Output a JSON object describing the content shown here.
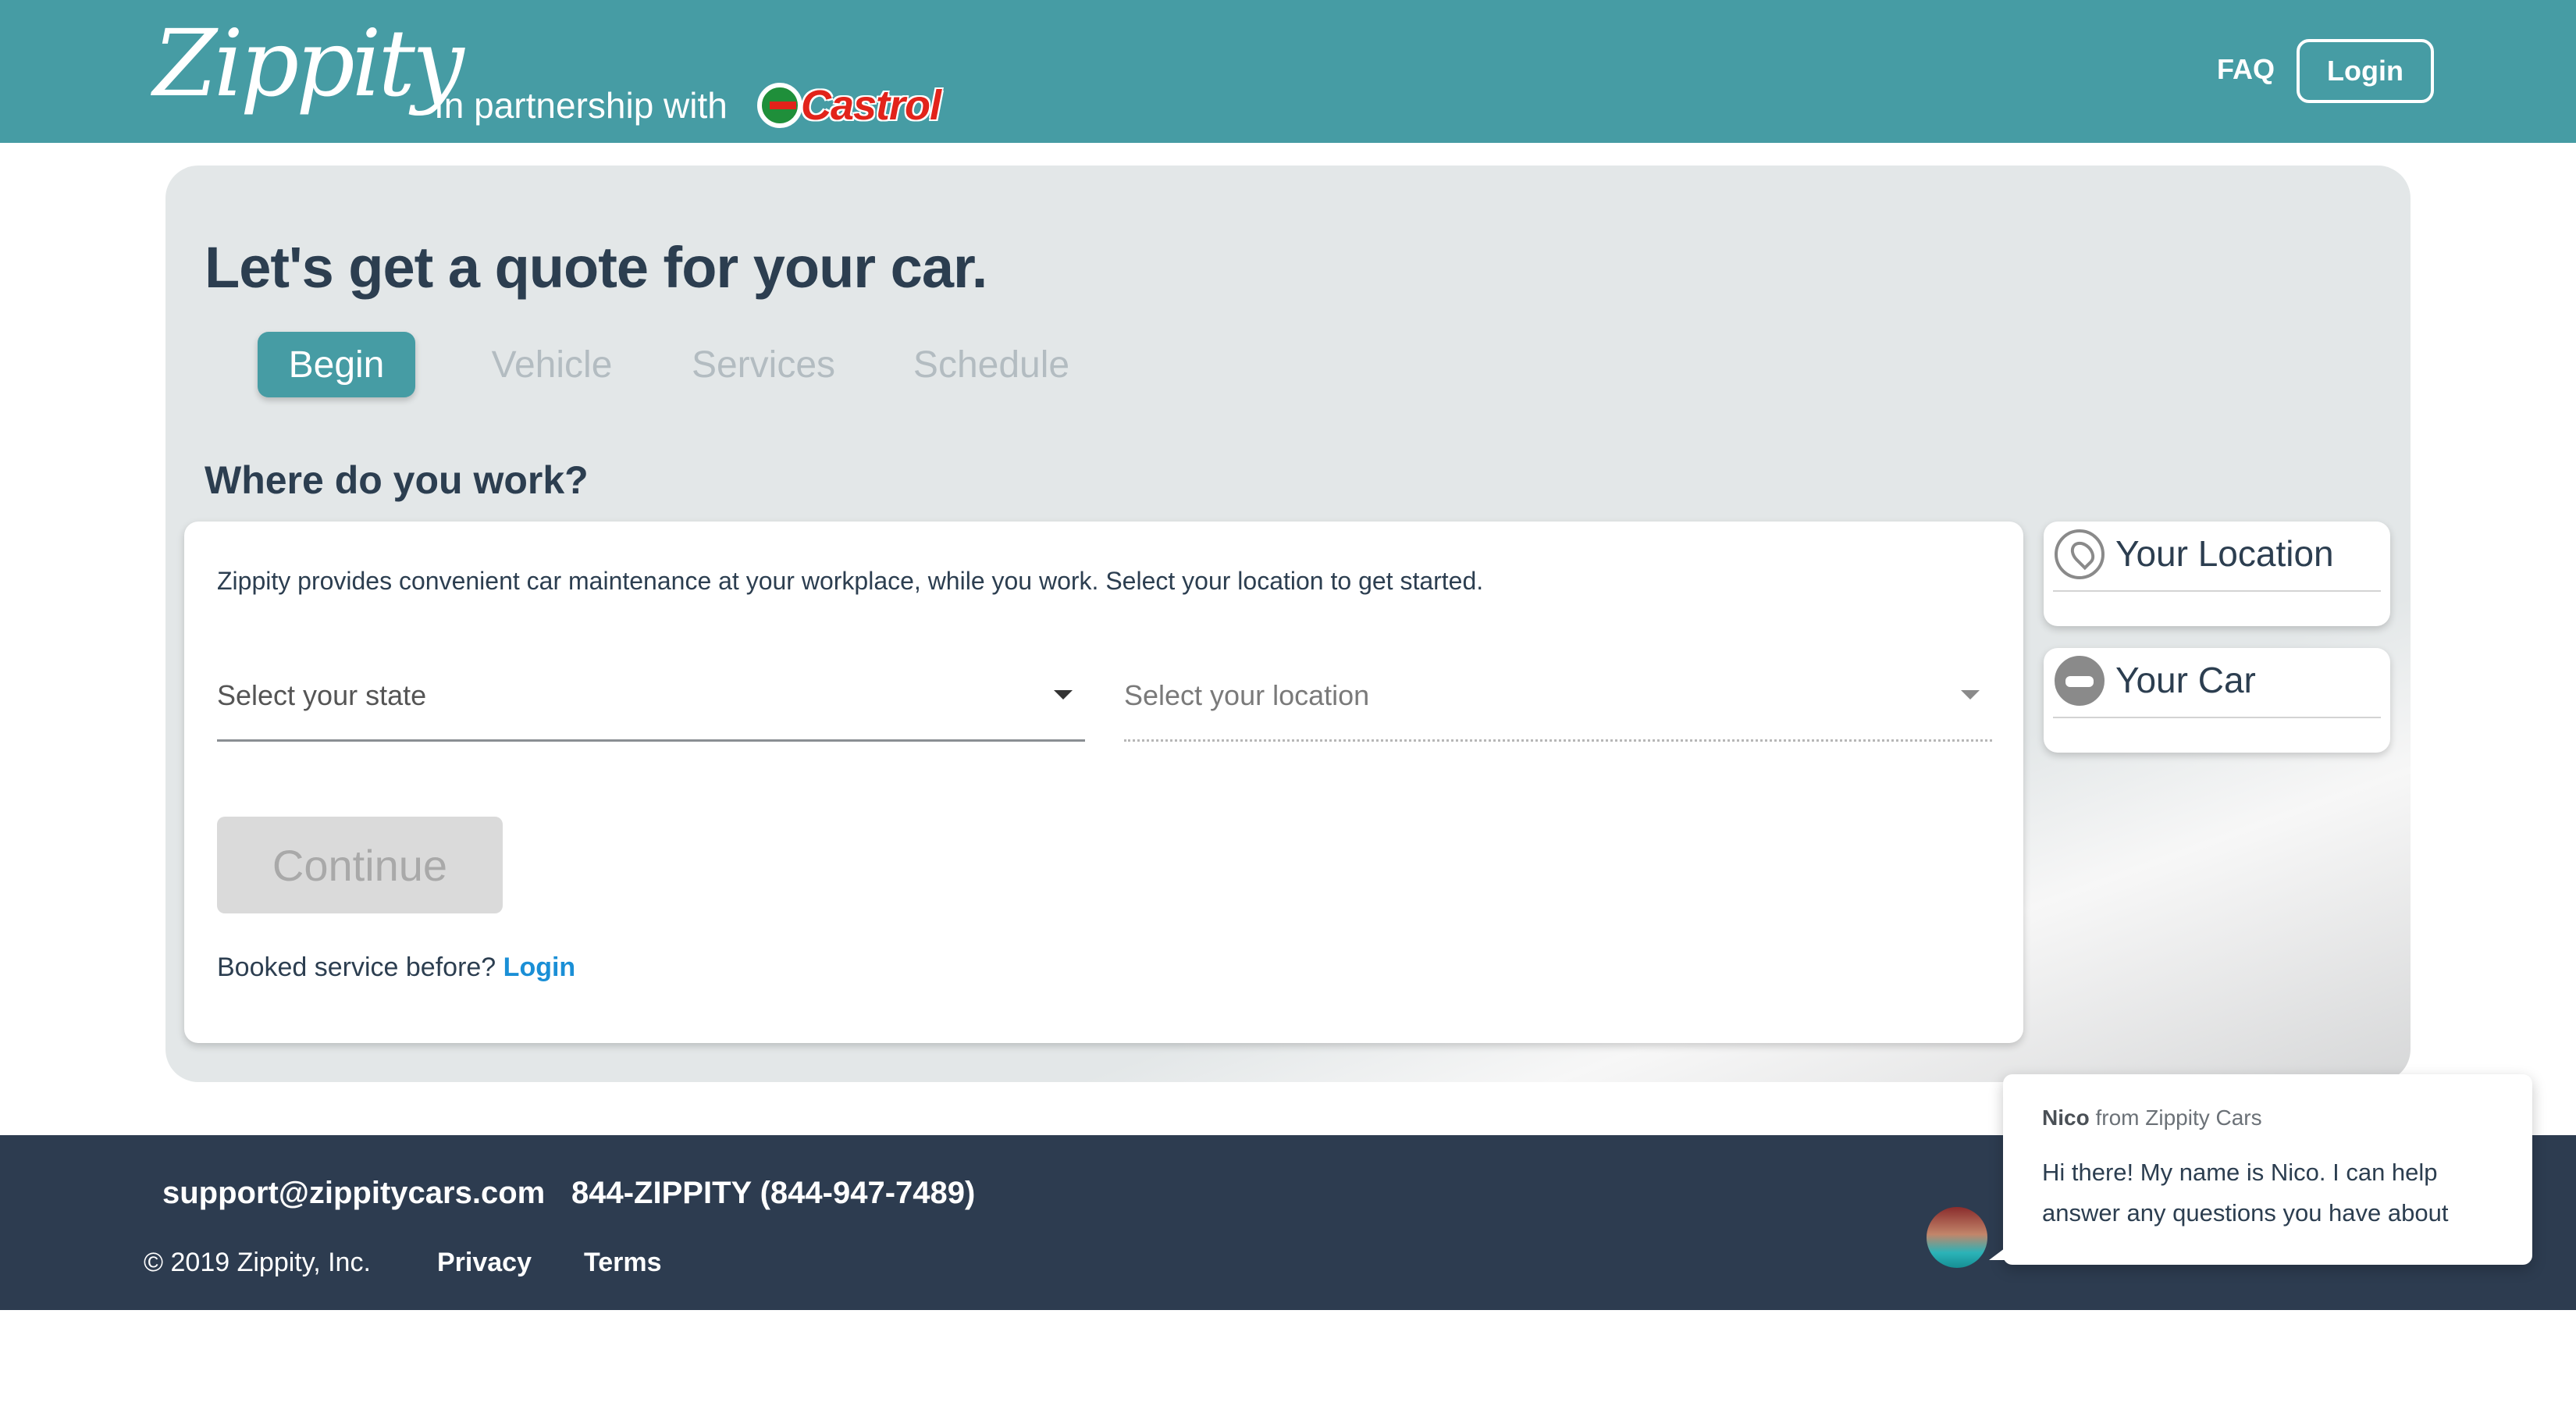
{
  "header": {
    "logo_text": "Zippity",
    "partnership_text": "In partnership with",
    "partner_logo_text": "Castrol",
    "faq_label": "FAQ",
    "login_label": "Login",
    "background_color": "#469ca4"
  },
  "main": {
    "title": "Let's get a quote for your car.",
    "steps": [
      {
        "label": "Begin",
        "active": true
      },
      {
        "label": "Vehicle",
        "active": false
      },
      {
        "label": "Services",
        "active": false
      },
      {
        "label": "Schedule",
        "active": false
      }
    ],
    "section_title": "Where do you work?",
    "intro_text": "Zippity provides convenient car maintenance at your workplace, while you work. Select your location to get started.",
    "state_select": {
      "placeholder": "Select your state",
      "icon": "chevron-down-icon"
    },
    "location_select": {
      "placeholder": "Select your location",
      "icon": "chevron-down-icon"
    },
    "continue_label": "Continue",
    "booked_prefix": "Booked service before?",
    "booked_login_label": "Login",
    "accent_color": "#469ca4",
    "link_color": "#1a8fd6"
  },
  "sidebar": {
    "items": [
      {
        "label": "Your Location",
        "icon": "location-pin-icon"
      },
      {
        "label": "Your Car",
        "icon": "car-icon"
      }
    ]
  },
  "footer": {
    "email": "support@zippitycars.com",
    "phone": "844-ZIPPITY (844-947-7489)",
    "copyright": "© 2019 Zippity, Inc.",
    "privacy_label": "Privacy",
    "terms_label": "Terms",
    "background_color": "#2d3c50"
  },
  "chat": {
    "sender_name": "Nico",
    "sender_suffix": "from Zippity Cars",
    "message": "Hi there! My name is Nico. I can help answer any questions you have about"
  }
}
